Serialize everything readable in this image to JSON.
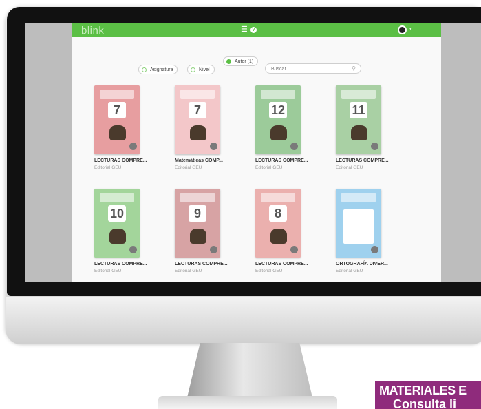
{
  "app": {
    "logo": "blink",
    "menu_icon": "menu-icon",
    "help_icon": "help-icon",
    "help_glyph": "?"
  },
  "filters": {
    "subject": "Asignatura",
    "level": "Nivel",
    "author": "Autor (1)",
    "search_placeholder": "Buscar..."
  },
  "books": [
    {
      "title": "LECTURAS COMPRE...",
      "publisher": "Editorial GEU",
      "cover_color": "#e79ea0",
      "number": "7"
    },
    {
      "title": "Matemáticas COMP...",
      "publisher": "Editorial GEU",
      "cover_color": "#f3c7c9",
      "number": "7"
    },
    {
      "title": "LECTURAS COMPRE...",
      "publisher": "Editorial GEU",
      "cover_color": "#9ccb9a",
      "number": "12"
    },
    {
      "title": "LECTURAS COMPRE...",
      "publisher": "Editorial GEU",
      "cover_color": "#a9d0a4",
      "number": "11"
    },
    {
      "title": "LECTURAS COMPRE...",
      "publisher": "Editorial GEU",
      "cover_color": "#a3d59b",
      "number": "10"
    },
    {
      "title": "LECTURAS COMPRE...",
      "publisher": "Editorial GEU",
      "cover_color": "#d7a3a4",
      "number": "9"
    },
    {
      "title": "LECTURAS COMPRE...",
      "publisher": "Editorial GEU",
      "cover_color": "#ebb0ae",
      "number": "8"
    },
    {
      "title": "ORTOGRAFÍA DIVER...",
      "publisher": "Editorial GEU",
      "cover_color": "#9fd1ee",
      "number": ""
    }
  ],
  "banner": {
    "line1": "MATERIALES E",
    "line2": "Consulta li"
  }
}
